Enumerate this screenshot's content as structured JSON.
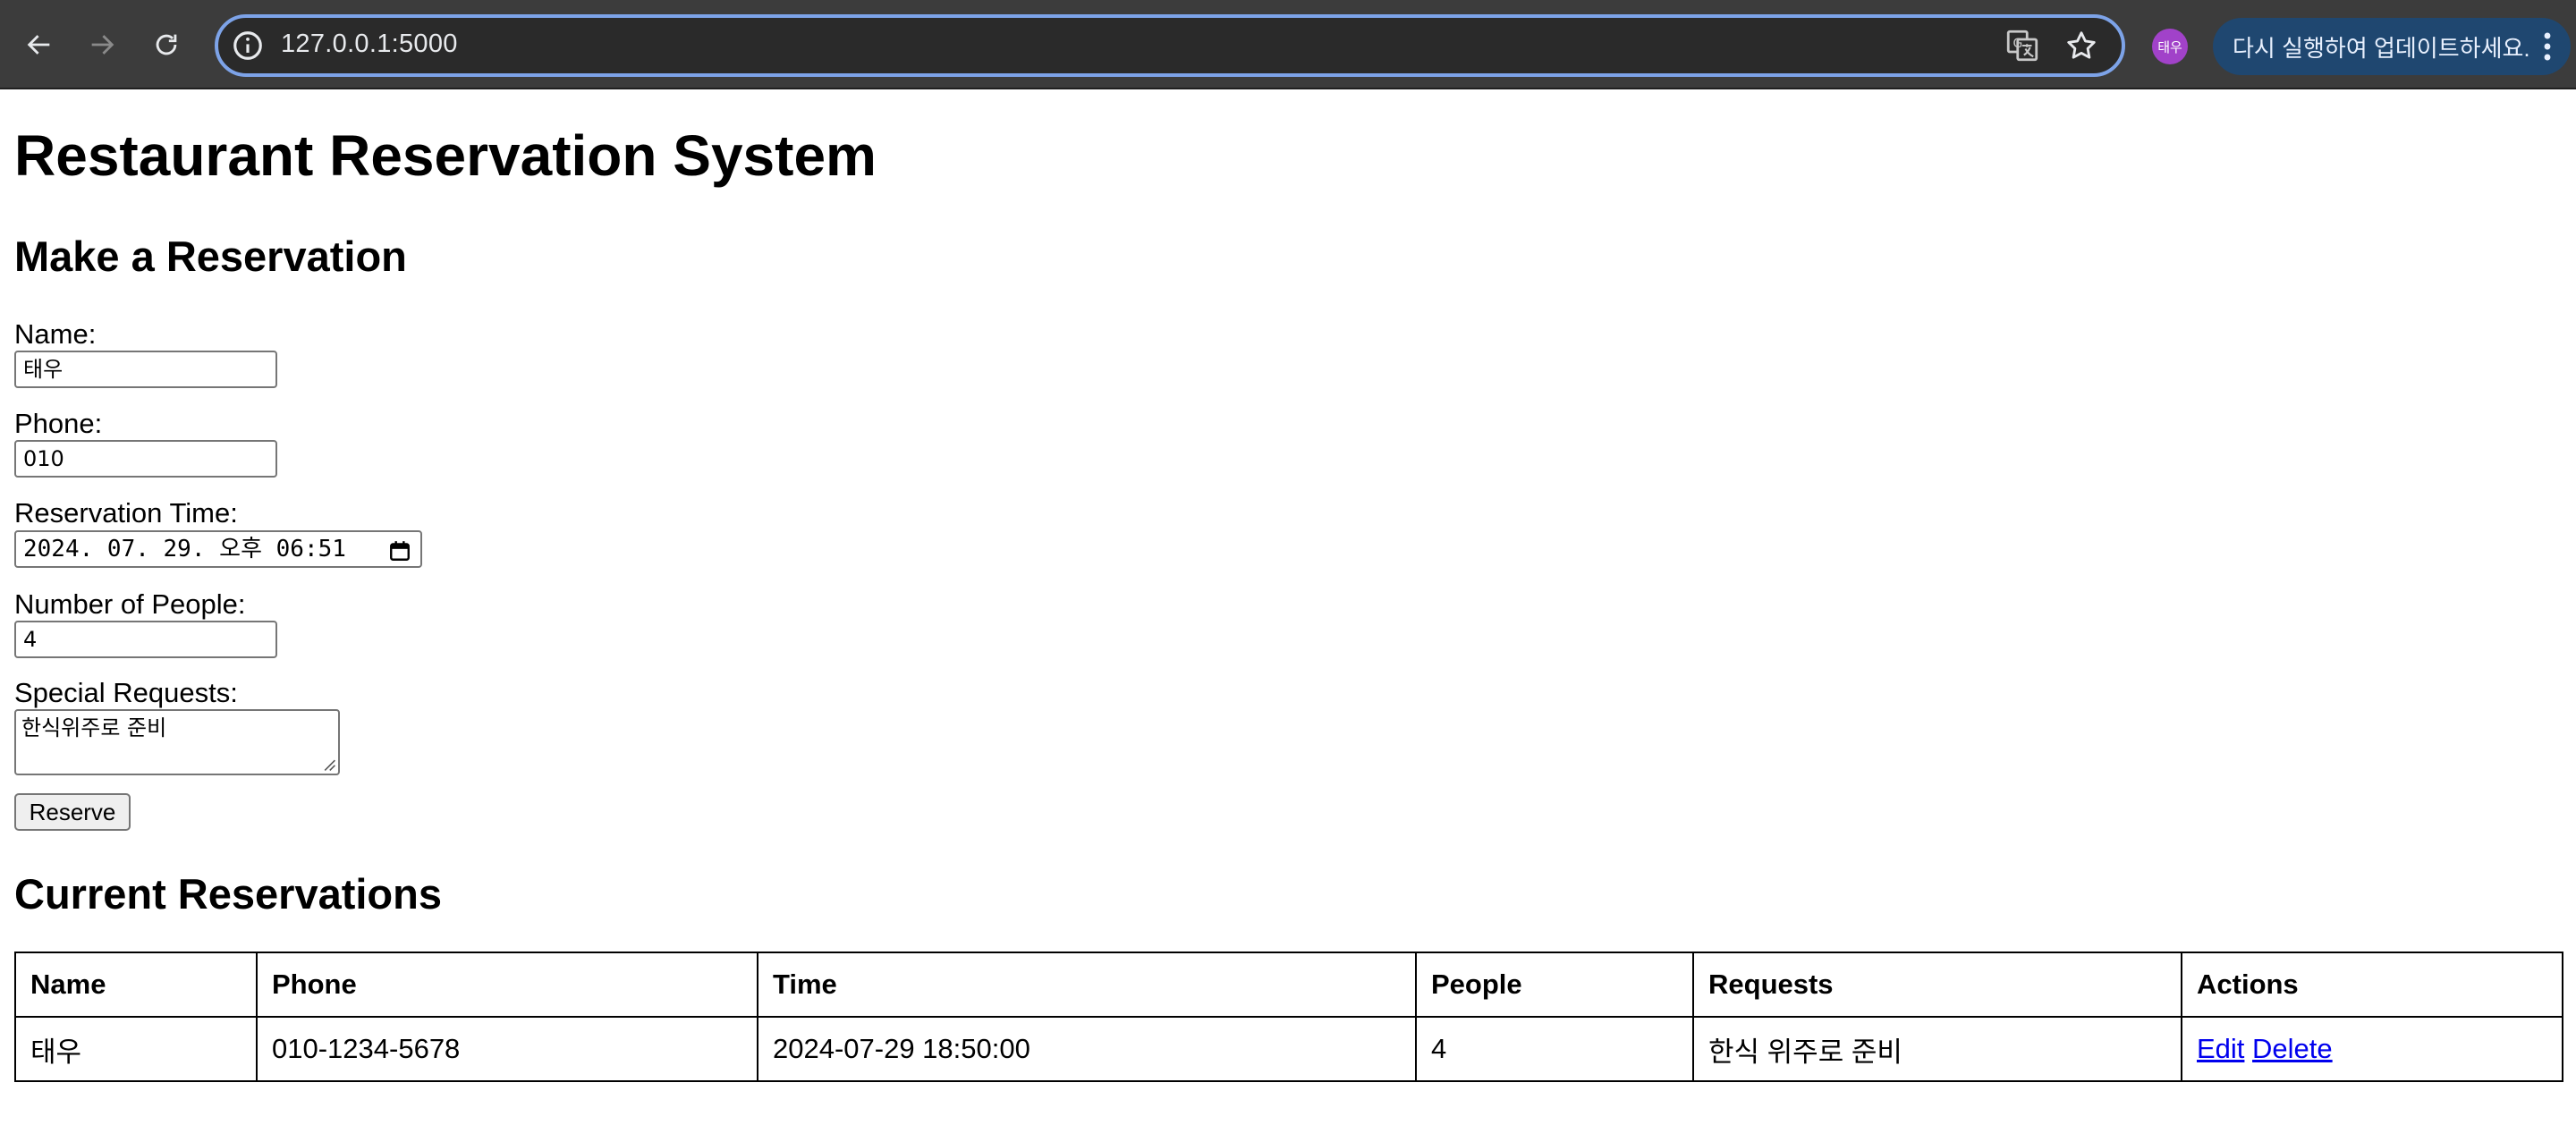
{
  "browser": {
    "url": "127.0.0.1:5000",
    "avatar_text": "태우",
    "update_text": "다시 실행하여 업데이트하세요.",
    "accent": "#7da3e8"
  },
  "page": {
    "title": "Restaurant Reservation System"
  },
  "form": {
    "heading": "Make a Reservation",
    "name_label": "Name:",
    "name_value": "태우",
    "phone_label": "Phone:",
    "phone_value": "010",
    "time_label": "Reservation Time:",
    "time_value": "2024. 07. 29. 오후 06:51",
    "people_label": "Number of People:",
    "people_value": "4",
    "requests_label": "Special Requests:",
    "requests_value": "한식위주로 준비",
    "submit_label": "Reserve"
  },
  "reservations": {
    "heading": "Current Reservations",
    "columns": [
      "Name",
      "Phone",
      "Time",
      "People",
      "Requests",
      "Actions"
    ],
    "rows": [
      {
        "name": "태우",
        "phone": "010-1234-5678",
        "time": "2024-07-29 18:50:00",
        "people": "4",
        "requests": "한식 위주로 준비",
        "edit_label": "Edit",
        "delete_label": "Delete"
      }
    ]
  }
}
